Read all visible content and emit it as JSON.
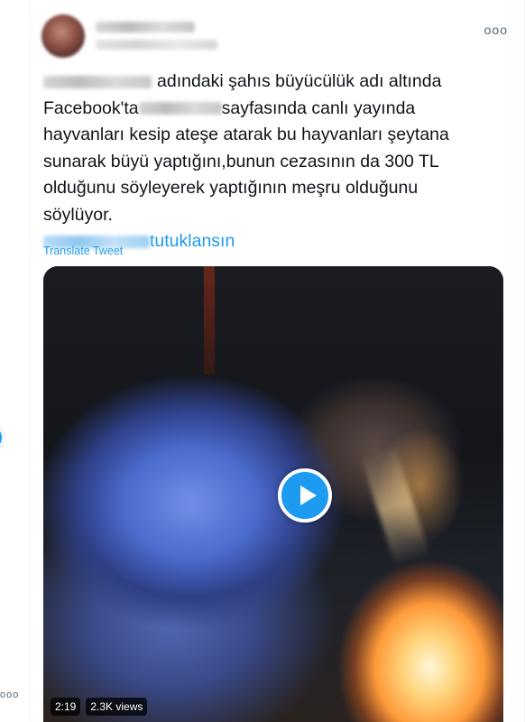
{
  "tweet": {
    "text": {
      "line1_after_blur": "adındaki şahıs büyücülük adı altında",
      "line2_before_blur": "Facebook'ta",
      "line2_after_blur": "sayfasında canlı yayında",
      "line3": "hayvanları kesip ateşe atarak bu hayvanları şeytana",
      "line4": "sunarak büyü yaptığını,bunun cezasının da 300 TL",
      "line5": "olduğunu söyleyerek yaptığının meşru olduğunu",
      "line6": "söylüyor.",
      "hashtag_visible": "tutuklansın"
    },
    "more_label": "ooo",
    "translate_label": "Translate Tweet",
    "video": {
      "duration": "2:19",
      "views": "2.3K views"
    }
  },
  "left_edge": {
    "dots": "ooo"
  },
  "colors": {
    "accent": "#1d9bf0",
    "text": "#0f1419",
    "secondary": "#536471"
  },
  "icons": {
    "more": "more-horizontal-icon",
    "play": "play-icon"
  }
}
